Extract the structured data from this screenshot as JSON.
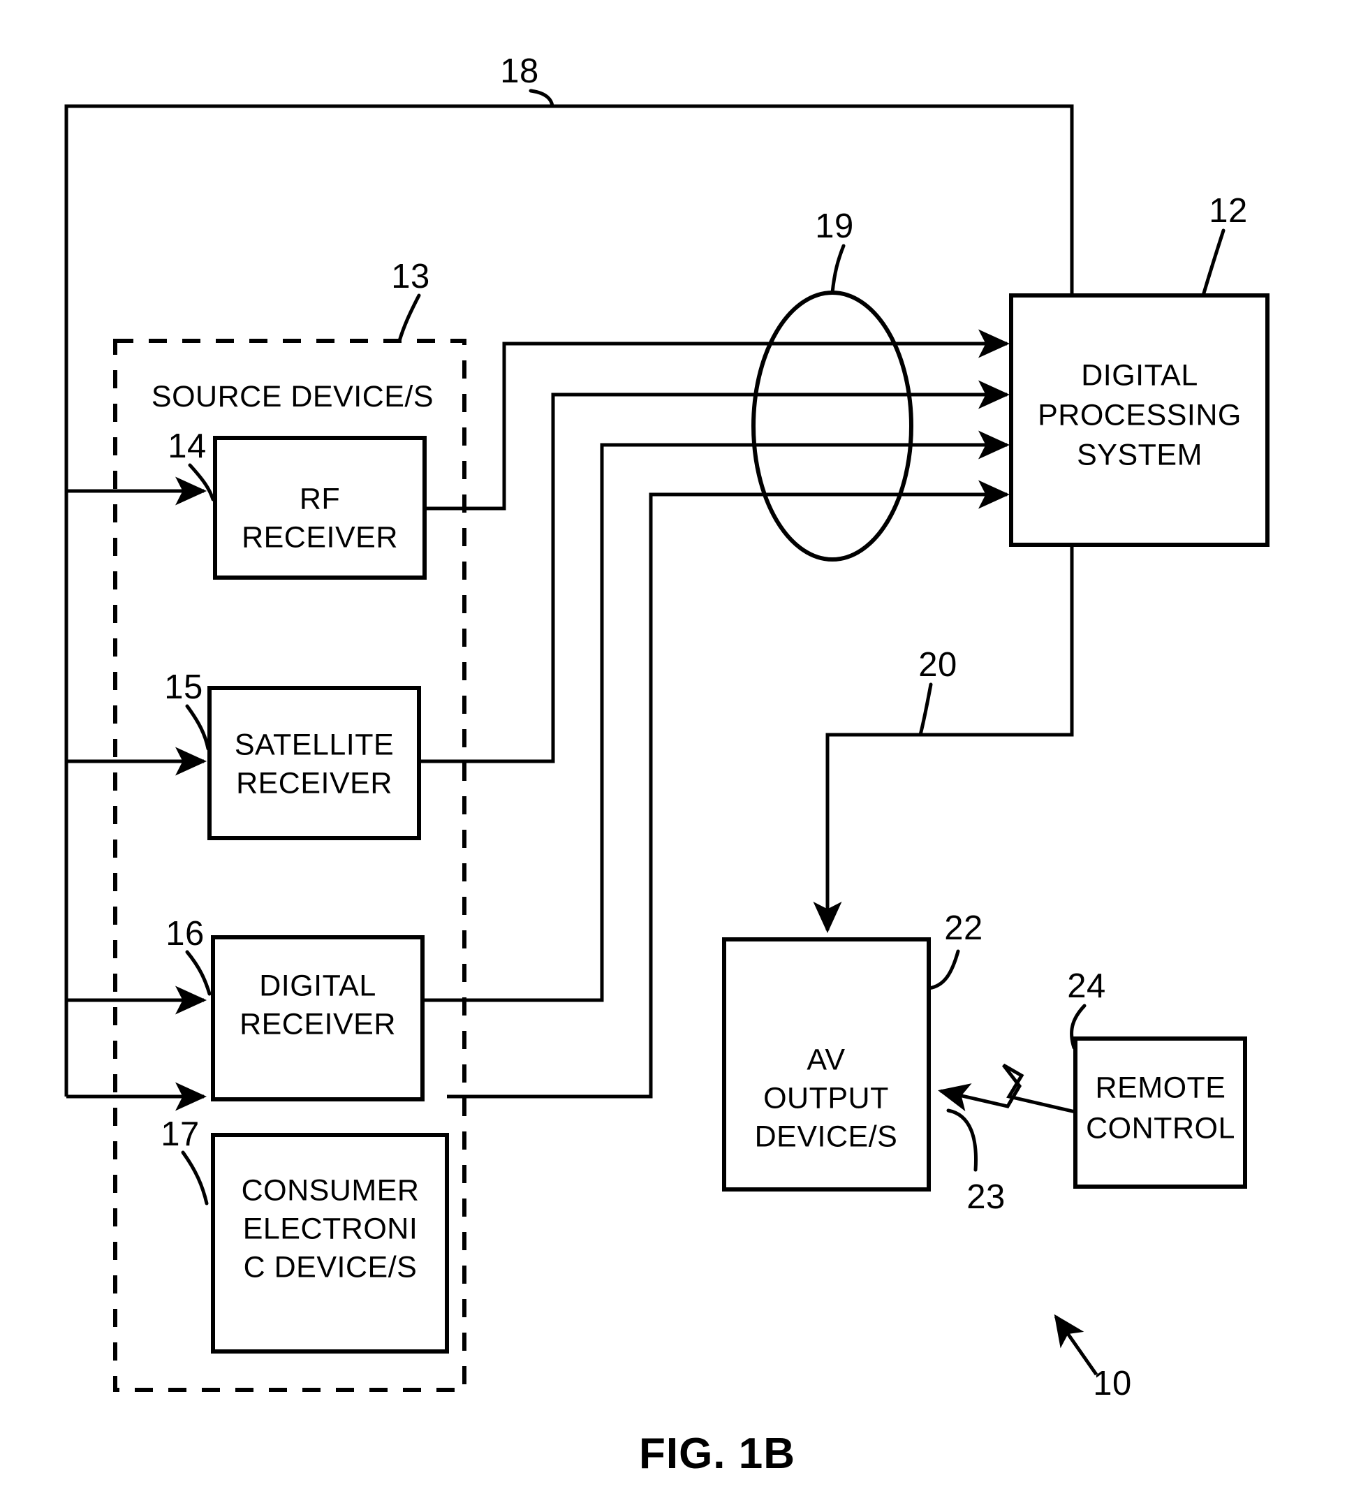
{
  "figure": {
    "caption": "FIG. 1B",
    "system_ref": "10"
  },
  "blocks": [
    {
      "id": "dps",
      "label_lines": [
        "DIGITAL",
        "PROCESSING",
        "SYSTEM"
      ],
      "ref": "12"
    },
    {
      "id": "rf",
      "label_lines": [
        "RF",
        "RECEIVER"
      ],
      "ref": "14"
    },
    {
      "id": "sat",
      "label_lines": [
        "SATELLITE",
        "RECEIVER"
      ],
      "ref": "15"
    },
    {
      "id": "digrx",
      "label_lines": [
        "DIGITAL",
        "RECEIVER"
      ],
      "ref": "16"
    },
    {
      "id": "ce",
      "label_lines": [
        "CONSUMER",
        "ELECTRONI",
        "C DEVICE/S"
      ],
      "ref": "17"
    },
    {
      "id": "av",
      "label_lines": [
        "AV",
        "OUTPUT",
        "DEVICE/S"
      ],
      "ref": "22"
    },
    {
      "id": "remote",
      "label_lines": [
        "REMOTE",
        "CONTROL"
      ],
      "ref": "24"
    }
  ],
  "groups": [
    {
      "id": "source_group",
      "label": "SOURCE DEVICE/S",
      "ref": "13"
    }
  ],
  "connections": [
    {
      "id": "control_bus",
      "ref": "18",
      "description": "control bus from digital processing system to source devices"
    },
    {
      "id": "signal_bundle",
      "ref": "19",
      "description": "signal bundle from source devices to digital processing system"
    },
    {
      "id": "av_link",
      "ref": "20",
      "description": "link from digital processing system to AV output device/s"
    },
    {
      "id": "remote_link",
      "ref": "23",
      "description": "wireless remote control signal to AV output device/s"
    }
  ],
  "colors": {
    "ink": "#000000",
    "paper": "#ffffff"
  }
}
